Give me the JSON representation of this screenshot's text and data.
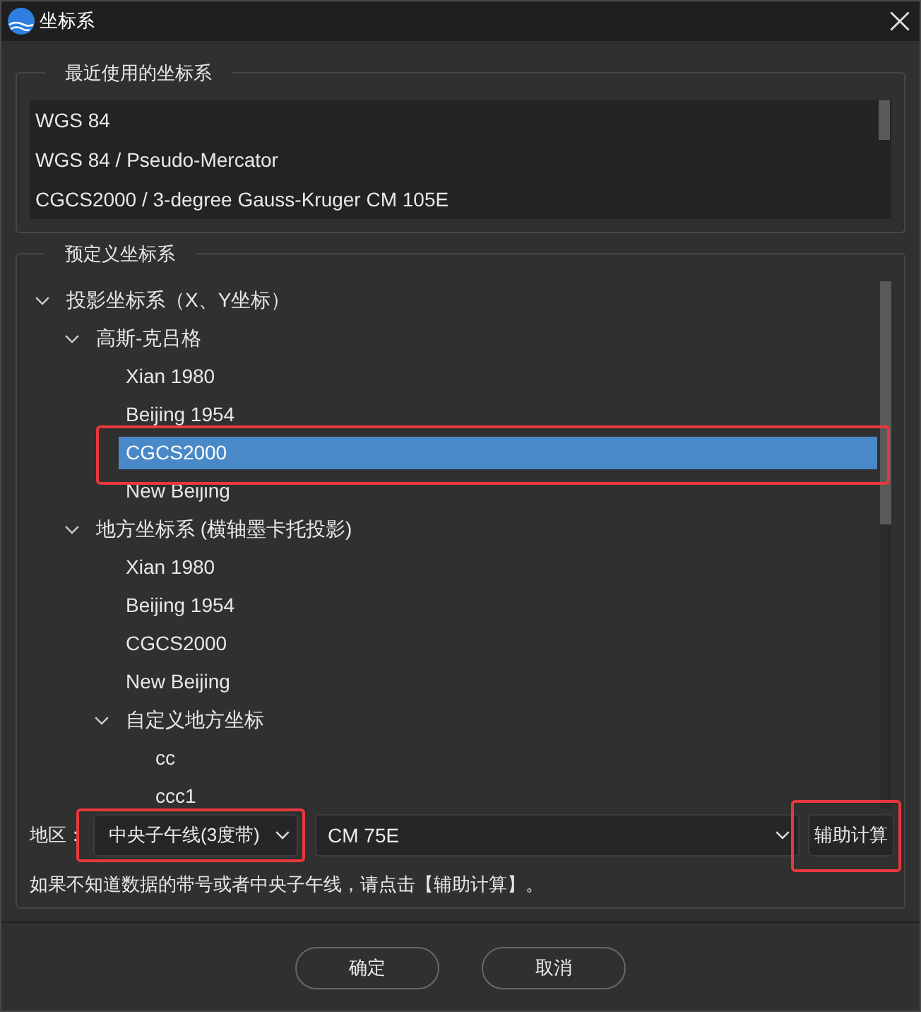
{
  "window": {
    "title": "坐标系"
  },
  "recent": {
    "title": "最近使用的坐标系",
    "items": [
      {
        "label": "WGS 84",
        "selected": false
      },
      {
        "label": "WGS 84 / Pseudo-Mercator",
        "selected": false
      },
      {
        "label": "CGCS2000 / 3-degree Gauss-Kruger CM 105E",
        "selected": false
      }
    ]
  },
  "predefined": {
    "title": "预定义坐标系",
    "tree": [
      {
        "label": "投影坐标系（X、Y坐标）",
        "expanded": true,
        "selected": false,
        "highlighted": false,
        "children": [
          {
            "label": "高斯-克吕格",
            "expanded": true,
            "selected": false,
            "highlighted": false,
            "children": [
              {
                "label": "Xian 1980",
                "selected": false,
                "highlighted": false
              },
              {
                "label": "Beijing 1954",
                "selected": false,
                "highlighted": false
              },
              {
                "label": "CGCS2000",
                "selected": true,
                "highlighted": true
              },
              {
                "label": "New Beijing",
                "selected": false,
                "highlighted": false
              }
            ]
          },
          {
            "label": "地方坐标系 (横轴墨卡托投影)",
            "expanded": true,
            "selected": false,
            "highlighted": false,
            "children": [
              {
                "label": "Xian 1980",
                "selected": false,
                "highlighted": false
              },
              {
                "label": "Beijing 1954",
                "selected": false,
                "highlighted": false
              },
              {
                "label": "CGCS2000",
                "selected": false,
                "highlighted": false
              },
              {
                "label": "New Beijing",
                "selected": false,
                "highlighted": false
              },
              {
                "label": "自定义地方坐标",
                "expanded": true,
                "selected": false,
                "highlighted": false,
                "children": [
                  {
                    "label": "cc",
                    "selected": false,
                    "highlighted": false
                  },
                  {
                    "label": "ccc1",
                    "selected": false,
                    "highlighted": false
                  }
                ]
              }
            ]
          }
        ]
      }
    ]
  },
  "region": {
    "label": "地区：",
    "zone": {
      "value": "中央子午线(3度带)",
      "highlighted": true
    },
    "meridian": {
      "value": "CM 75E",
      "highlighted": false
    },
    "helper_button": {
      "label": "辅助计算",
      "highlighted": true
    }
  },
  "hint": "如果不知道数据的带号或者中央子午线，请点击【辅助计算】。",
  "buttons": [
    {
      "label": "确定"
    },
    {
      "label": "取消"
    }
  ]
}
